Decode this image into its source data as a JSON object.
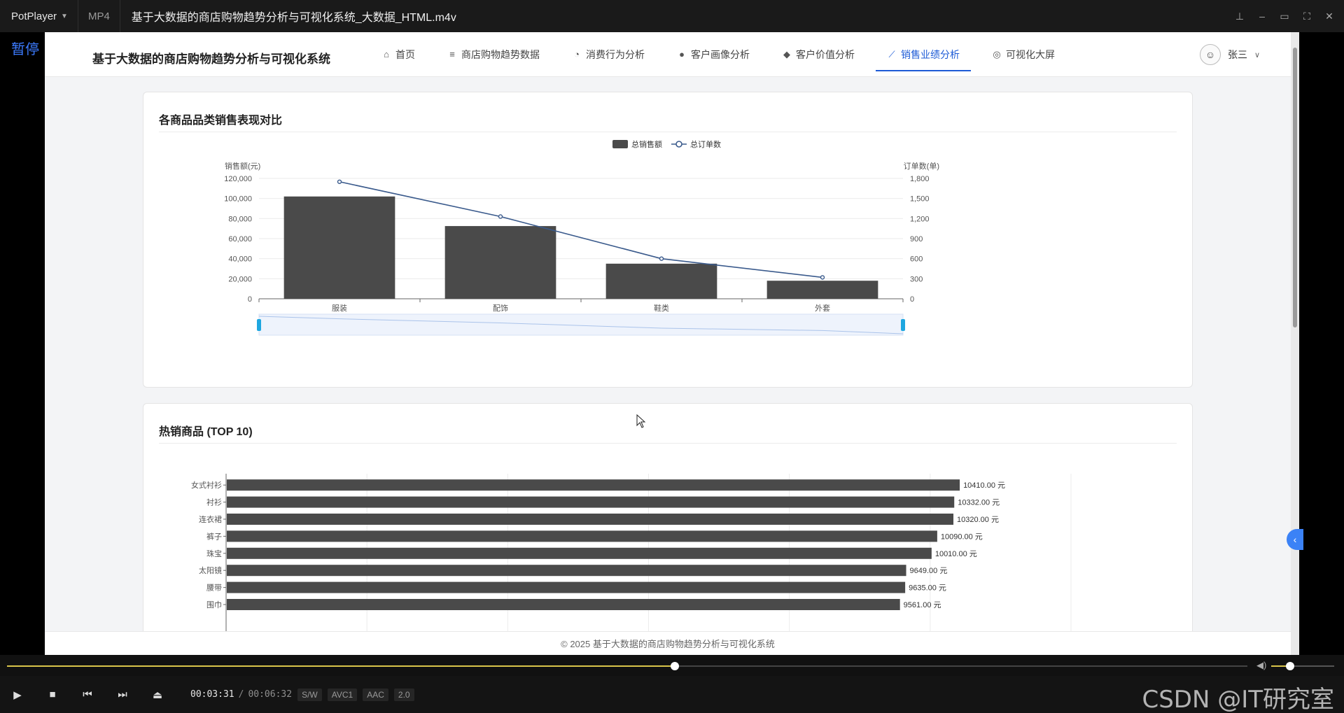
{
  "player": {
    "brand": "PotPlayer",
    "format": "MP4",
    "file_title": "基于大数据的商店购物趋势分析与可视化系统_大数据_HTML.m4v",
    "status_overlay": "暂停",
    "current_time": "00:03:31",
    "duration": "00:06:32",
    "badges": [
      "S/W",
      "AVC1",
      "AAC",
      "2.0"
    ],
    "progress": 0.5381,
    "volume": 0.3,
    "watermark": "CSDN @IT研究室"
  },
  "site": {
    "brand": "基于大数据的商店购物趋势分析与可视化系统",
    "nav": [
      {
        "label": "首页",
        "icon": "home-icon",
        "active": false
      },
      {
        "label": "商店购物趋势数据",
        "icon": "database-icon",
        "active": false
      },
      {
        "label": "消费行为分析",
        "icon": "pie-chart-icon",
        "active": false
      },
      {
        "label": "客户画像分析",
        "icon": "user-icon",
        "active": false
      },
      {
        "label": "客户价值分析",
        "icon": "gem-icon",
        "active": false
      },
      {
        "label": "销售业绩分析",
        "icon": "line-chart-icon",
        "active": true
      },
      {
        "label": "可视化大屏",
        "icon": "dashboard-icon",
        "active": false
      }
    ],
    "user_name": "张三",
    "footer": "© 2025 基于大数据的商店购物趋势分析与可视化系统"
  },
  "card1": {
    "title": "各商品品类销售表现对比"
  },
  "card2": {
    "title": "热销商品 (TOP 10)"
  },
  "chart_data": [
    {
      "type": "bar",
      "title": "各商品品类销售表现对比",
      "categories": [
        "服装",
        "配饰",
        "鞋类",
        "外套"
      ],
      "series": [
        {
          "name": "总销售额",
          "type": "bar",
          "axis": "left",
          "values": [
            102000,
            72500,
            35000,
            18000
          ],
          "color": "#4a4a4a"
        },
        {
          "name": "总订单数",
          "type": "line",
          "axis": "right",
          "values": [
            1750,
            1230,
            600,
            320
          ],
          "color": "#3a5a8c"
        }
      ],
      "ylabel": "销售额(元)",
      "y2label": "订单数(单)",
      "ylim": [
        0,
        120000
      ],
      "yticks": [
        "0",
        "20,000",
        "40,000",
        "60,000",
        "80,000",
        "100,000",
        "120,000"
      ],
      "y2lim": [
        0,
        1800
      ],
      "y2ticks": [
        "0",
        "300",
        "600",
        "900",
        "1,200",
        "1,500",
        "1,800"
      ],
      "legend": "top-center",
      "grid": true,
      "data_zoom": true
    },
    {
      "type": "bar",
      "orientation": "horizontal",
      "title": "热销商品 (TOP 10)",
      "categories": [
        "女式衬衫",
        "衬衫",
        "连衣裙",
        "裤子",
        "珠宝",
        "太阳镜",
        "腰带",
        "围巾"
      ],
      "values": [
        10410.0,
        10332.0,
        10320.0,
        10090.0,
        10010.0,
        9649.0,
        9635.0,
        9561.0
      ],
      "value_labels": [
        "10410.00 元",
        "10332.00 元",
        "10320.00 元",
        "10090.00 元",
        "10010.00 元",
        "9649.00 元",
        "9635.00 元",
        "9561.00 元"
      ],
      "xlim": [
        0,
        12000
      ],
      "color": "#4a4a4a",
      "grid": true
    }
  ]
}
